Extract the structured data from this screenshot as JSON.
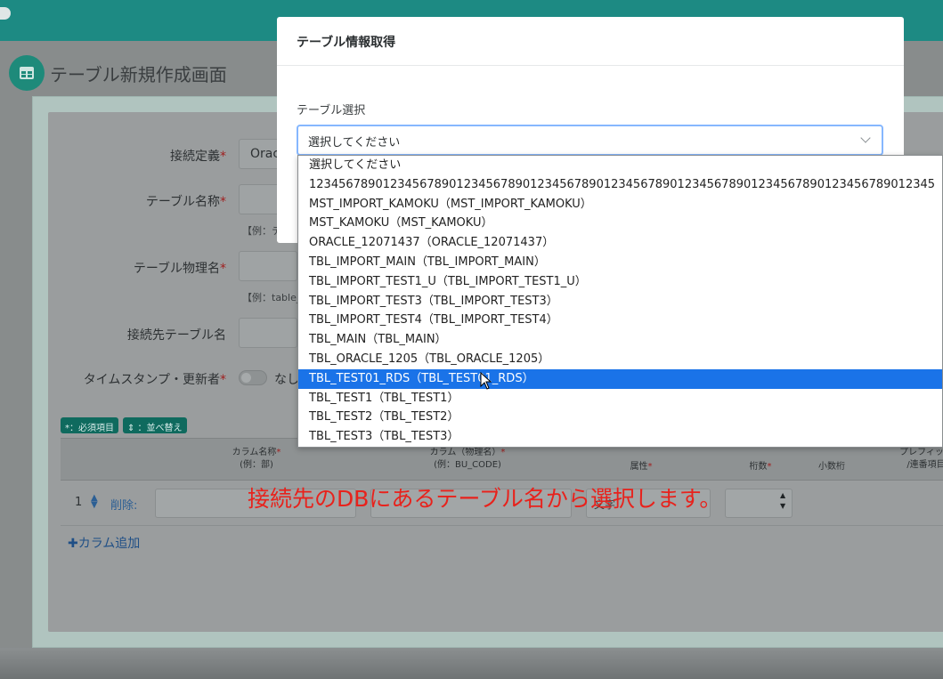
{
  "page": {
    "title": "テーブル新規作成画面"
  },
  "form": {
    "connection_label": "接続定義",
    "connection_value": "Orac",
    "table_name_label": "テーブル名称",
    "table_name_hint": "【例：テ",
    "physical_name_label": "テーブル物理名",
    "physical_name_hint": "【例：table_",
    "target_table_label": "接続先テーブル名",
    "timestamp_label": "タイムスタンプ・更新者",
    "timestamp_toggle_text": "なし",
    "required_mark": "*"
  },
  "badges": {
    "required": "*：必須項目",
    "sort": "⇕ ：並べ替え"
  },
  "columns_table": {
    "headers": [
      {
        "line1": "カラム名称",
        "line2": "(例：部)",
        "required": true
      },
      {
        "line1": "カラム（物理名）",
        "line2": "(例：BU_CODE)",
        "required": true
      },
      {
        "line1": "属性",
        "line2": "",
        "required": true
      },
      {
        "line1": "桁数",
        "line2": "",
        "required": true
      },
      {
        "line1": "小数桁",
        "line2": "",
        "required": false
      },
      {
        "line1": "プレフィック",
        "line2": "/連番項目",
        "required": false
      }
    ],
    "row_number": "1",
    "delete_label": "削除:",
    "attribute_value": "文字",
    "add_column_label": "✚カラム追加"
  },
  "modal": {
    "title": "テーブル情報取得",
    "field_label": "テーブル選択",
    "select_value": "選択してください"
  },
  "dropdown": {
    "selected_index": 10,
    "options": [
      "選択してください",
      "1234567890123456789012345678901234567890123456789012345678901234567890123456789012345",
      "MST_IMPORT_KAMOKU（MST_IMPORT_KAMOKU）",
      "MST_KAMOKU（MST_KAMOKU）",
      "ORACLE_12071437（ORACLE_12071437）",
      "TBL_IMPORT_MAIN（TBL_IMPORT_MAIN）",
      "TBL_IMPORT_TEST1_U（TBL_IMPORT_TEST1_U）",
      "TBL_IMPORT_TEST3（TBL_IMPORT_TEST3）",
      "TBL_IMPORT_TEST4（TBL_IMPORT_TEST4）",
      "TBL_MAIN（TBL_MAIN）",
      "TBL_ORACLE_1205（TBL_ORACLE_1205）",
      "TBL_TEST01_RDS（TBL_TEST01_RDS）",
      "TBL_TEST1（TBL_TEST1）",
      "TBL_TEST2（TBL_TEST2）",
      "TBL_TEST3（TBL_TEST3）"
    ]
  },
  "caption": "接続先のDBにあるテーブル名から選択します。",
  "colors": {
    "topbar": "#1d8a83",
    "accent": "#1a73e8",
    "caption": "#e8221c"
  },
  "icons": {
    "page_icon": "table-icon",
    "select_chevron": "chevron-down-icon",
    "logo": "cloud-icon"
  }
}
